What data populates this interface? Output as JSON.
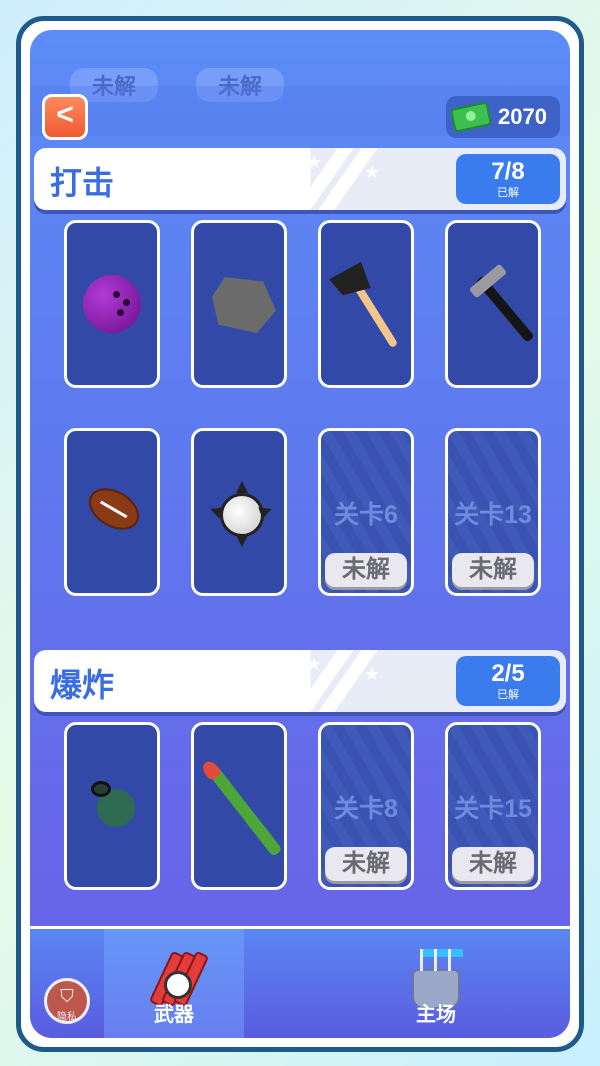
{
  "top_ghost": [
    "未解",
    "未解"
  ],
  "header": {
    "back": "<",
    "money": "2070"
  },
  "sections": [
    {
      "title": "打击",
      "count": "7/8",
      "sub": "已解",
      "items": [
        {
          "name": "bowling-ball"
        },
        {
          "name": "rock"
        },
        {
          "name": "axe"
        },
        {
          "name": "hammer"
        },
        {
          "name": "football"
        },
        {
          "name": "spiked-ball"
        },
        {
          "level": "关卡6",
          "status": "未解"
        },
        {
          "level": "关卡13",
          "status": "未解"
        }
      ]
    },
    {
      "title": "爆炸",
      "count": "2/5",
      "sub": "已解",
      "items": [
        {
          "name": "grenade"
        },
        {
          "name": "rpg-launcher"
        },
        {
          "level": "关卡8",
          "status": "未解"
        },
        {
          "level": "关卡15",
          "status": "未解"
        }
      ]
    }
  ],
  "nav": {
    "weapons": "武器",
    "home": "主场",
    "privacy": "隐私"
  },
  "colors": {
    "accent": "#3a7bee",
    "background_top": "#5b8cf7",
    "background_bottom": "#6a5fe6"
  }
}
